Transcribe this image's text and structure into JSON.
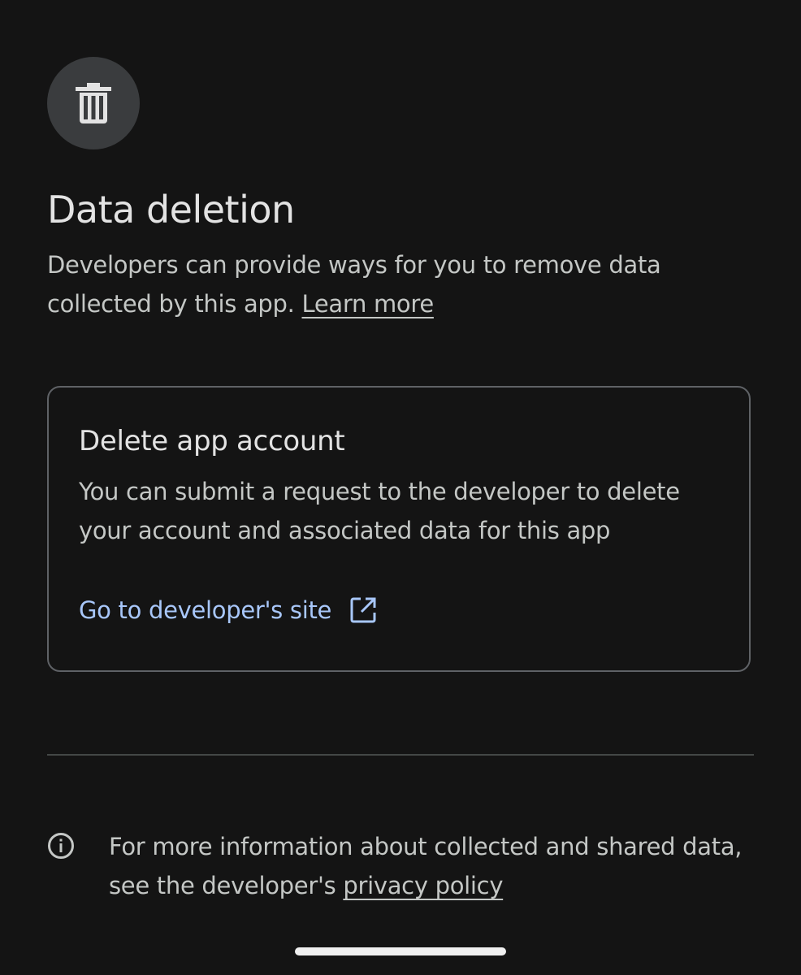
{
  "header": {
    "icon": "trash-icon",
    "title": "Data deletion",
    "description": "Developers can provide ways for you to remove data collected by this app.",
    "learn_more": "Learn more"
  },
  "card": {
    "title": "Delete app account",
    "body": "You can submit a request to the developer to delete your account and associated data for this app",
    "link_label": "Go to developer's site",
    "link_icon": "open-in-new-icon"
  },
  "footer": {
    "icon": "info-icon",
    "text": "For more information about collected and shared data, see the developer's",
    "privacy_link": "privacy policy"
  },
  "colors": {
    "background": "#141414",
    "link": "#a8c7fa",
    "card_border": "#5f6266"
  }
}
